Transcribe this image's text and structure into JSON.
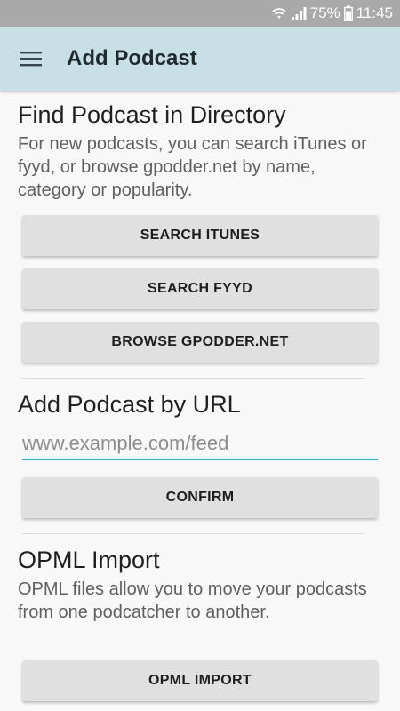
{
  "status_bar": {
    "battery": "75%",
    "time": "11:45",
    "icons": [
      "wifi-icon",
      "signal-icon"
    ]
  },
  "app_bar": {
    "menu_icon": "hamburger-menu-icon",
    "title": "Add Podcast"
  },
  "directory": {
    "title": "Find Podcast in Directory",
    "description": "For new podcasts, you can search iTunes or fyyd, or browse gpodder.net by name, category or popularity.",
    "buttons": {
      "itunes": "SEARCH ITUNES",
      "fyyd": "SEARCH FYYD",
      "gpodder": "BROWSE GPODDER.NET"
    }
  },
  "by_url": {
    "title": "Add Podcast by URL",
    "placeholder": "www.example.com/feed",
    "value": "",
    "confirm": "CONFIRM"
  },
  "opml": {
    "title": "OPML Import",
    "description": "OPML files allow you to move your podcasts from one podcatcher to another.",
    "button": "OPML IMPORT"
  },
  "colors": {
    "app_bar": "#c8dfe6",
    "status_bar": "#a9a9a9",
    "accent": "#2ea6d6",
    "button": "#e0e0e0"
  }
}
